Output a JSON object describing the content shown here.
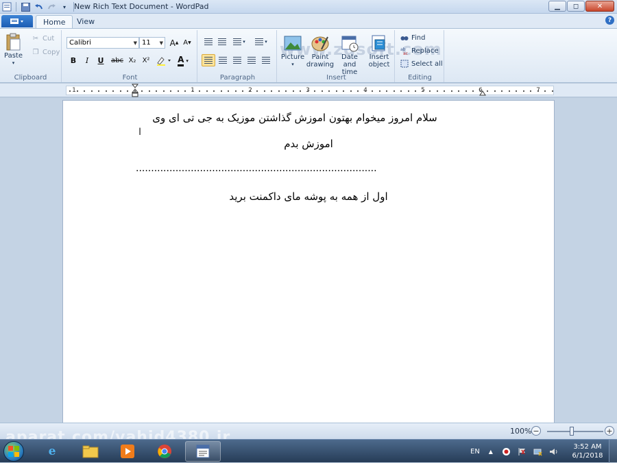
{
  "window": {
    "title": "New Rich Text Document - WordPad",
    "minimize": "▁",
    "maximize": "◻",
    "close": "✕"
  },
  "tabs": [
    {
      "label": "Home",
      "active": true
    },
    {
      "label": "View",
      "active": false
    }
  ],
  "watermark_top": "www.zdsoft.com",
  "ribbon": {
    "clipboard": {
      "label": "Clipboard",
      "paste": "Paste",
      "cut": "Cut",
      "copy": "Copy"
    },
    "font": {
      "label": "Font",
      "family": "Calibri",
      "size": "11",
      "bold": "B",
      "italic": "I",
      "underline": "U",
      "strike": "abc",
      "subscript": "X₂",
      "superscript": "X²",
      "grow": "A",
      "shrink": "A",
      "color_letter": "A"
    },
    "paragraph": {
      "label": "Paragraph"
    },
    "insert": {
      "label": "Insert",
      "picture": "Picture",
      "paint_line1": "Paint",
      "paint_line2": "drawing",
      "date_line1": "Date and",
      "date_line2": "time",
      "object_line1": "Insert",
      "object_line2": "object"
    },
    "editing": {
      "label": "Editing",
      "find": "Find",
      "replace": "Replace",
      "select_all": "Select all"
    }
  },
  "ruler": {
    "numbers": [
      "1",
      "1",
      "2",
      "3",
      "4",
      "5",
      "6",
      "7"
    ]
  },
  "document": {
    "line1": "سلام امروز میخوام بهتون اموزش گذاشتن موزیک به جی تی ای وی",
    "line2": "اموزش بدم",
    "separator": "...............................................................................",
    "line3": "اول از همه به پوشه مای داکمنت برید"
  },
  "statusbar": {
    "zoom": "100%",
    "zoom_percent": 100
  },
  "watermark_bottom": "aparat.com/vahid4380.ir",
  "taskbar": {
    "language": "EN",
    "time": "3:52 AM",
    "date": "6/1/2018"
  },
  "colors": {
    "ribbon_bg": "#dde8f4",
    "accent": "#2f6fc4",
    "active_button": "#fbe39a"
  }
}
